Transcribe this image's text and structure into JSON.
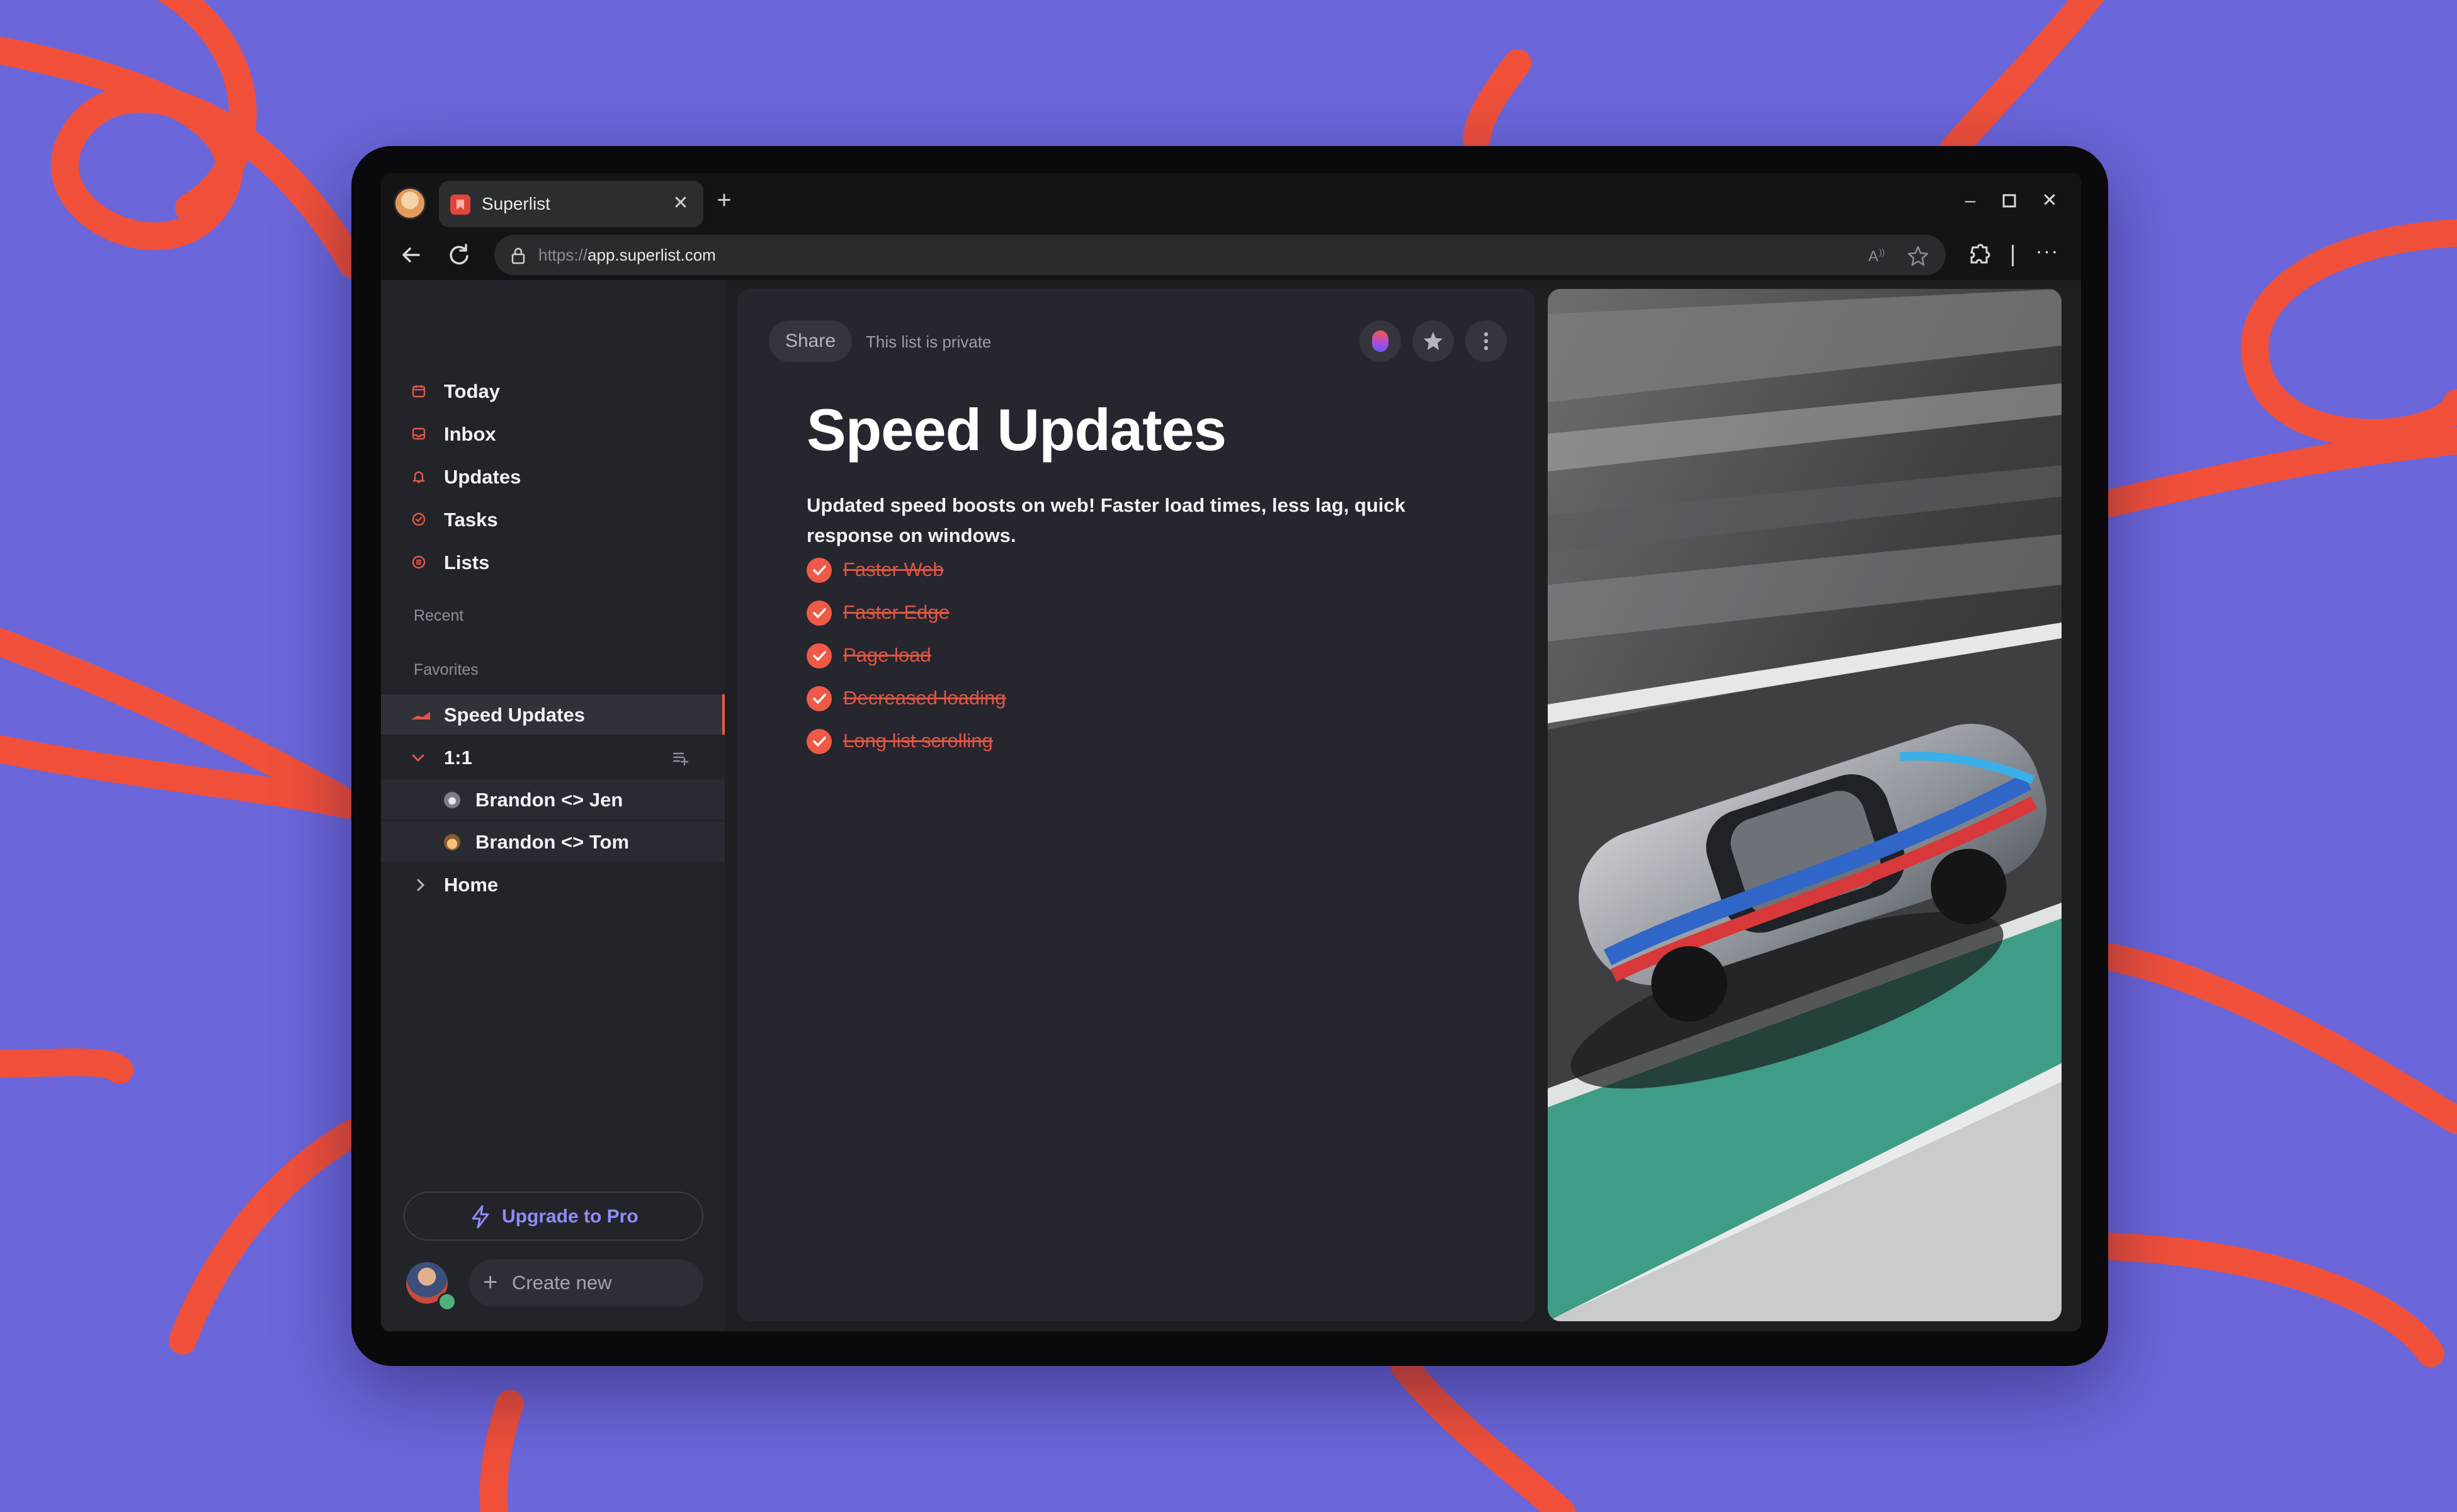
{
  "browser": {
    "tab_title": "Superlist",
    "url_protocol": "https://",
    "url_host": "app.superlist.com"
  },
  "sidebar": {
    "nav": [
      {
        "label": "Today",
        "icon": "calendar-icon"
      },
      {
        "label": "Inbox",
        "icon": "inbox-icon"
      },
      {
        "label": "Updates",
        "icon": "bell-icon"
      },
      {
        "label": "Tasks",
        "icon": "check-circle-icon"
      },
      {
        "label": "Lists",
        "icon": "list-icon"
      }
    ],
    "recent_label": "Recent",
    "favorites_label": "Favorites",
    "favorites": [
      {
        "label": "Speed Updates",
        "icon": "speed-icon"
      },
      {
        "label": "1:1",
        "icon": "chevron-down-icon"
      },
      {
        "label": "Brandon <> Jen",
        "icon": "koala-emoji-icon"
      },
      {
        "label": "Brandon <> Tom",
        "icon": "person-emoji-icon"
      },
      {
        "label": "Home",
        "icon": "chevron-right-icon"
      }
    ],
    "upgrade_label": "Upgrade to Pro",
    "create_label": "Create new"
  },
  "main": {
    "share_label": "Share",
    "privacy_label": "This list is private",
    "title": "Speed Updates",
    "description": "Updated speed boosts on web! Faster load times, less lag, quick response on windows.",
    "tasks": [
      {
        "label": "Faster Web",
        "done": true
      },
      {
        "label": "Faster Edge",
        "done": true
      },
      {
        "label": "Page load",
        "done": true
      },
      {
        "label": "Decreased loading",
        "done": true
      },
      {
        "label": "Long list scrolling",
        "done": true
      }
    ]
  },
  "colors": {
    "background": "#6b67da",
    "swirl": "#f0503a",
    "accent": "#ef5a46",
    "upgrade": "#8f8cf8"
  }
}
